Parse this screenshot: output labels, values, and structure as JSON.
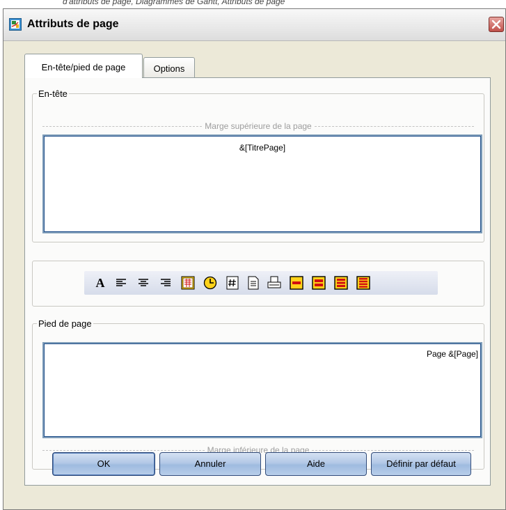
{
  "top_strip_text": "d'attributs de page, Diagrammes de Gantt, Attributs de page",
  "window": {
    "title": "Attributs de page"
  },
  "tabs": [
    {
      "label": "En-tête/pied de page",
      "active": true
    },
    {
      "label": "Options",
      "active": false
    }
  ],
  "header_group": {
    "legend": "En-tête",
    "margin_label": "Marge supérieure de la page",
    "content": "&[TitrePage]"
  },
  "footer_group": {
    "legend": "Pied de page",
    "margin_label": "Marge inférieure de la page",
    "content": "Page &[Page]"
  },
  "toolbar": {
    "icons": [
      "font-icon",
      "align-left-icon",
      "align-center-icon",
      "align-right-icon",
      "date-icon",
      "time-icon",
      "page-number-icon",
      "document-icon",
      "print-icon",
      "insert-column-icon",
      "insert-column-2-icon",
      "insert-column-3-icon",
      "insert-column-4-icon"
    ]
  },
  "buttons": {
    "ok": "OK",
    "cancel": "Annuler",
    "help": "Aide",
    "default": "Définir par défaut"
  },
  "colors": {
    "accent_border": "#1e4e8a",
    "button_gradient_top": "#d5e2f3",
    "icon_yellow": "#ffd21a",
    "icon_red": "#d01010"
  }
}
